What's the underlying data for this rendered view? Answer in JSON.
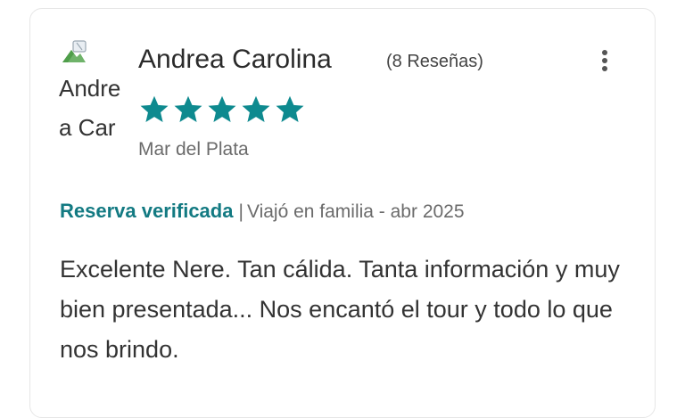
{
  "review": {
    "avatar_alt": "Andrea Carolina",
    "reviewer_name": "Andrea Carolina",
    "review_count": "(8 Reseñas)",
    "rating": 5,
    "max_rating": 5,
    "location": "Mar del Plata",
    "verified_label": "Reserva verificada",
    "separator": "|",
    "trip_info": "Viajó en familia - abr 2025",
    "text": "Excelente Nere. Tan cálida. Tanta información y muy bien presentada... Nos encantó el tour y todo lo que nos brindo."
  },
  "icons": {
    "star": "star-icon",
    "more": "more-vertical-icon",
    "avatar_broken": "broken-image-icon"
  },
  "colors": {
    "star": "#0e8a8f",
    "verified": "#137a82",
    "text": "#333333",
    "muted": "#6b6b6b",
    "border": "#e6e6e6"
  }
}
